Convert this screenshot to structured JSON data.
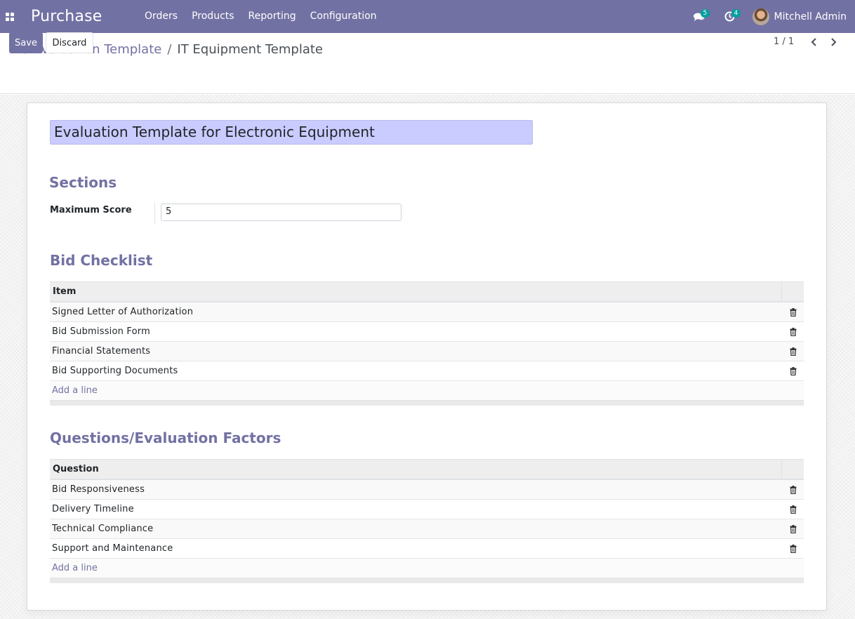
{
  "navbar": {
    "app_name": "Purchase",
    "menu": [
      "Orders",
      "Products",
      "Reporting",
      "Configuration"
    ],
    "messages_count": "5",
    "activities_count": "4",
    "user_name": "Mitchell Admin"
  },
  "breadcrumb": {
    "parent": "Bid Evaluation Template",
    "separator": "/",
    "current": "IT Equipment Template"
  },
  "buttons": {
    "save": "Save",
    "discard": "Discard"
  },
  "pager": {
    "value": "1 / 1"
  },
  "form": {
    "name": "Evaluation Template for Electronic Equipment",
    "sections_title": "Sections",
    "max_score_label": "Maximum Score",
    "max_score_value": "5",
    "checklist": {
      "title": "Bid Checklist",
      "column": "Item",
      "rows": [
        "Signed Letter of Authorization",
        "Bid Submission Form",
        "Financial Statements",
        "Bid Supporting Documents"
      ],
      "add_line": "Add a line"
    },
    "questions": {
      "title": "Questions/Evaluation Factors",
      "column": "Question",
      "rows": [
        "Bid Responsiveness",
        "Delivery Timeline",
        "Technical Compliance",
        "Support and Maintenance"
      ],
      "add_line": "Add a line"
    }
  },
  "colors": {
    "brand": "#7271a3",
    "badge": "#00a09d",
    "title_field_bg": "#cacbff"
  },
  "icons": [
    "apps-icon",
    "chat-icon",
    "clock-icon",
    "chevron-left-icon",
    "chevron-right-icon",
    "trash-icon"
  ]
}
